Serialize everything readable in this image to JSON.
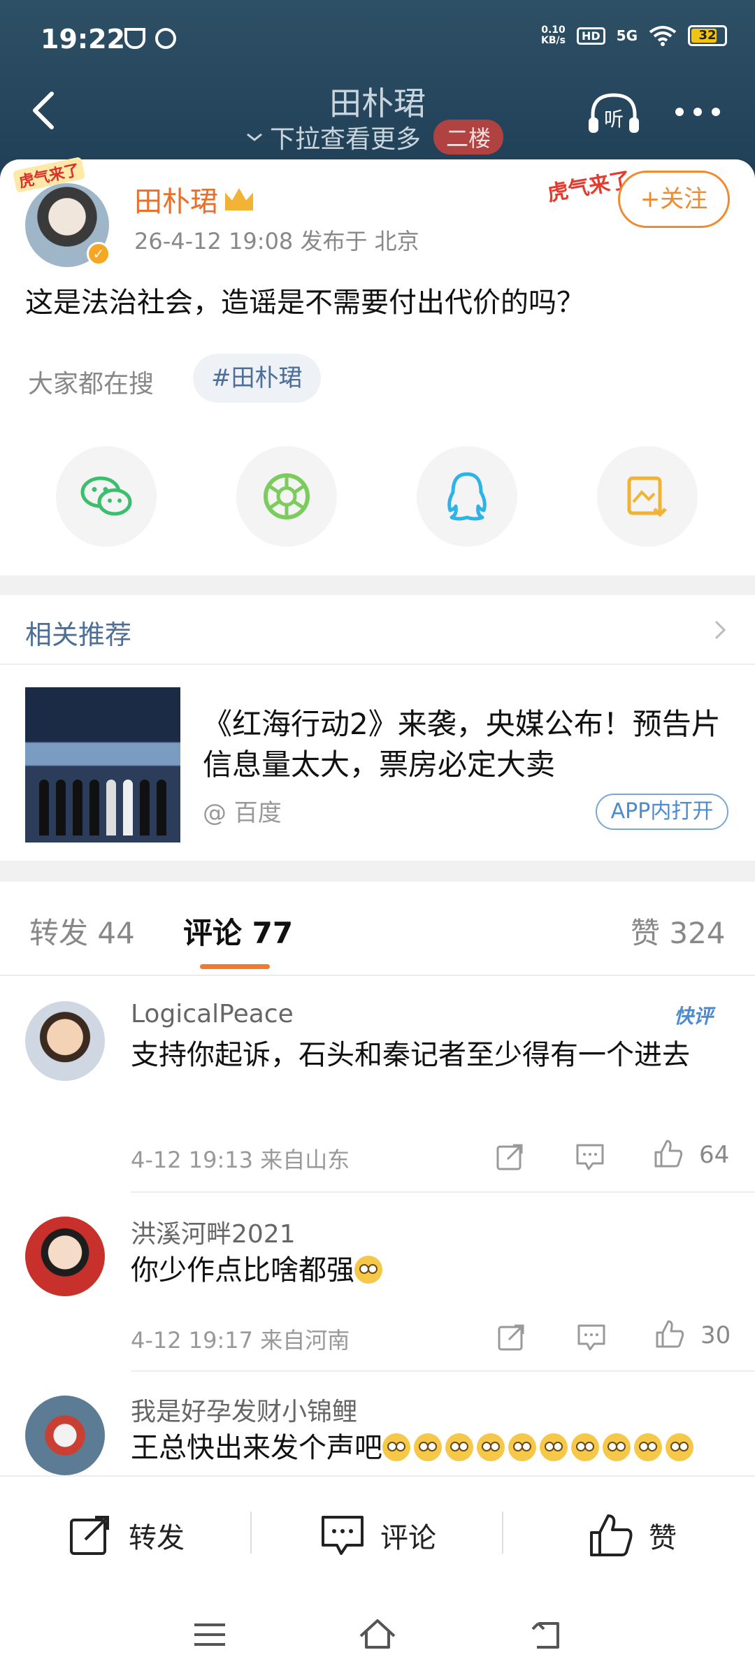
{
  "status_bar": {
    "time": "19:22",
    "net_speed_top": "0.10",
    "net_speed_unit": "KB/s",
    "hd": "HD",
    "signal": "5G",
    "battery": "32"
  },
  "nav": {
    "title": "田朴珺",
    "subtitle": "下拉查看更多",
    "floor_badge": "二楼"
  },
  "post": {
    "author": "田朴珺",
    "meta": "26-4-12 19:08  发布于 北京",
    "follow_label": "+关注",
    "deco_text": "虎气来了",
    "avatar_tag": "虎气来了",
    "text": "这是法治社会，造谣是不需要付出代价的吗？",
    "search_label": "大家都在搜",
    "hashtag": "#田朴珺"
  },
  "share_icons": [
    "wechat-icon",
    "moments-icon",
    "qq-icon",
    "save-image-icon"
  ],
  "recommend": {
    "header": "相关推荐",
    "title": "《红海行动2》来袭，央媒公布！预告片信息量太大，票房必定大卖",
    "source": "@ 百度",
    "open_in_app": "APP内打开"
  },
  "tabs": {
    "repost": "转发 44",
    "comments": "评论 77",
    "likes": "赞 324"
  },
  "comments": [
    {
      "name": "LogicalPeace",
      "text": "支持你起诉，石头和秦记者至少得有一个进去",
      "meta": "4-12 19:13  来自山东",
      "likes": "64",
      "badge": "快评"
    },
    {
      "name": "洪溪河畔2021",
      "text": "你少作点比啥都强",
      "meta": "4-12 19:17  来自河南",
      "likes": "30"
    },
    {
      "name": "我是好孕发财小锦鲤",
      "text": "王总快出来发个声吧"
    }
  ],
  "bottom_bar": {
    "repost": "转发",
    "comment": "评论",
    "like": "赞"
  },
  "colors": {
    "accent": "#f07c2a",
    "link": "#4d6e96",
    "header_bg": "#2e5065"
  }
}
